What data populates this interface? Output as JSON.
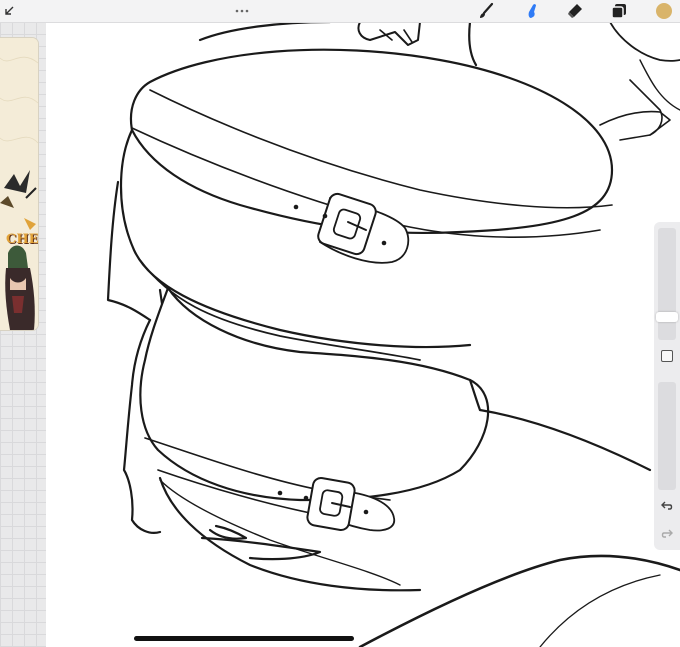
{
  "app": {
    "accent_color": "#2f7bf6",
    "current_color": "#d9b46a",
    "tools": [
      {
        "name": "brush",
        "icon": "brush-icon",
        "active": false
      },
      {
        "name": "smudge",
        "icon": "smudge-icon",
        "active": true
      },
      {
        "name": "eraser",
        "icon": "eraser-icon",
        "active": false
      },
      {
        "name": "layers",
        "icon": "layers-icon",
        "active": false
      }
    ]
  },
  "reference": {
    "visible_text": "CHE"
  },
  "sidebar": {
    "undo_icon": "undo-icon",
    "redo_icon": "redo-icon",
    "size_level": 0.82,
    "opacity_level": 0.1
  }
}
